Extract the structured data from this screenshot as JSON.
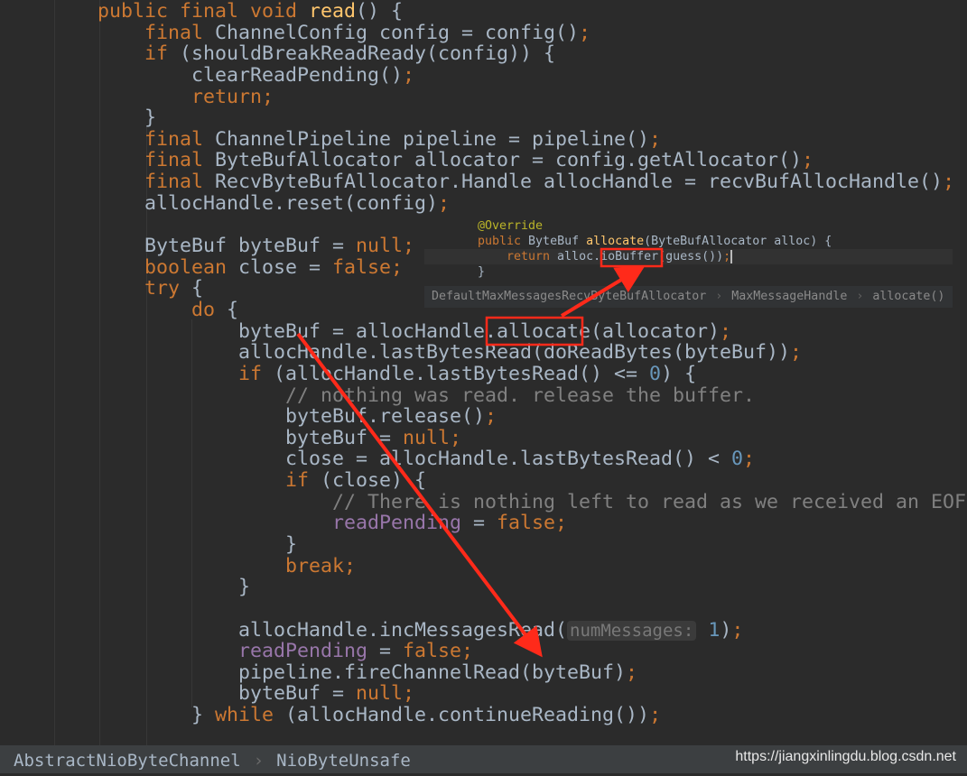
{
  "editor": {
    "lines": [
      {
        "indent": 0,
        "tokens": [
          [
            "k",
            "public final void "
          ],
          [
            "m",
            "read"
          ],
          [
            "t",
            "() {"
          ]
        ]
      },
      {
        "indent": 1,
        "tokens": [
          [
            "k",
            "final "
          ],
          [
            "t",
            "ChannelConfig config = config()"
          ],
          [
            "k",
            ";"
          ]
        ]
      },
      {
        "indent": 1,
        "tokens": [
          [
            "k",
            "if "
          ],
          [
            "t",
            "(shouldBreakReadReady(config)) {"
          ]
        ]
      },
      {
        "indent": 2,
        "tokens": [
          [
            "t",
            "clearReadPending()"
          ],
          [
            "k",
            ";"
          ]
        ]
      },
      {
        "indent": 2,
        "tokens": [
          [
            "k",
            "return;"
          ]
        ]
      },
      {
        "indent": 1,
        "tokens": [
          [
            "t",
            "}"
          ]
        ]
      },
      {
        "indent": 1,
        "tokens": [
          [
            "k",
            "final "
          ],
          [
            "t",
            "ChannelPipeline pipeline = pipeline()"
          ],
          [
            "k",
            ";"
          ]
        ]
      },
      {
        "indent": 1,
        "tokens": [
          [
            "k",
            "final "
          ],
          [
            "t",
            "ByteBufAllocator allocator = config.getAllocator()"
          ],
          [
            "k",
            ";"
          ]
        ]
      },
      {
        "indent": 1,
        "tokens": [
          [
            "k",
            "final "
          ],
          [
            "t",
            "RecvByteBufAllocator.Handle allocHandle = recvBufAllocHandle()"
          ],
          [
            "k",
            ";"
          ]
        ]
      },
      {
        "indent": 1,
        "tokens": [
          [
            "t",
            "allocHandle.reset(config)"
          ],
          [
            "k",
            ";"
          ]
        ]
      },
      {
        "indent": 0,
        "tokens": []
      },
      {
        "indent": 1,
        "tokens": [
          [
            "t",
            "ByteBuf byteBuf = "
          ],
          [
            "k",
            "null;"
          ]
        ]
      },
      {
        "indent": 1,
        "tokens": [
          [
            "k",
            "boolean "
          ],
          [
            "t",
            "close = "
          ],
          [
            "k",
            "false;"
          ]
        ]
      },
      {
        "indent": 1,
        "tokens": [
          [
            "k",
            "try "
          ],
          [
            "t",
            "{"
          ]
        ]
      },
      {
        "indent": 2,
        "tokens": [
          [
            "k",
            "do "
          ],
          [
            "t",
            "{"
          ]
        ]
      },
      {
        "indent": 3,
        "tokens": [
          [
            "t",
            "byteBuf = allocHandle.allocate(allocator)"
          ],
          [
            "k",
            ";"
          ]
        ]
      },
      {
        "indent": 3,
        "tokens": [
          [
            "t",
            "allocHandle.lastBytesRead(doReadBytes(byteBuf))"
          ],
          [
            "k",
            ";"
          ]
        ]
      },
      {
        "indent": 3,
        "tokens": [
          [
            "k",
            "if "
          ],
          [
            "t",
            "(allocHandle.lastBytesRead() <= "
          ],
          [
            "n",
            "0"
          ],
          [
            "t",
            ") {"
          ]
        ]
      },
      {
        "indent": 4,
        "tokens": [
          [
            "c",
            "// nothing was read. release the buffer."
          ]
        ]
      },
      {
        "indent": 4,
        "tokens": [
          [
            "t",
            "byteBuf.release()"
          ],
          [
            "k",
            ";"
          ]
        ]
      },
      {
        "indent": 4,
        "tokens": [
          [
            "t",
            "byteBuf = "
          ],
          [
            "k",
            "null;"
          ]
        ]
      },
      {
        "indent": 4,
        "tokens": [
          [
            "t",
            "close = allocHandle.lastBytesRead() < "
          ],
          [
            "n",
            "0"
          ],
          [
            "k",
            ";"
          ]
        ]
      },
      {
        "indent": 4,
        "tokens": [
          [
            "k",
            "if "
          ],
          [
            "t",
            "(close) {"
          ]
        ]
      },
      {
        "indent": 5,
        "tokens": [
          [
            "c",
            "// There is nothing left to read as we received an EOF."
          ]
        ]
      },
      {
        "indent": 5,
        "tokens": [
          [
            "f",
            "readPending"
          ],
          [
            "t",
            " = "
          ],
          [
            "k",
            "false;"
          ]
        ]
      },
      {
        "indent": 4,
        "tokens": [
          [
            "t",
            "}"
          ]
        ]
      },
      {
        "indent": 4,
        "tokens": [
          [
            "k",
            "break;"
          ]
        ]
      },
      {
        "indent": 3,
        "tokens": [
          [
            "t",
            "}"
          ]
        ]
      },
      {
        "indent": 0,
        "tokens": []
      },
      {
        "indent": 3,
        "tokens": [
          [
            "t",
            "allocHandle.incMessagesRead("
          ],
          [
            "h",
            "numMessages:"
          ],
          [
            "t",
            " "
          ],
          [
            "n",
            "1"
          ],
          [
            "t",
            ")"
          ],
          [
            "k",
            ";"
          ]
        ]
      },
      {
        "indent": 3,
        "tokens": [
          [
            "f",
            "readPending"
          ],
          [
            "t",
            " = "
          ],
          [
            "k",
            "false;"
          ]
        ]
      },
      {
        "indent": 3,
        "tokens": [
          [
            "t",
            "pipeline.fireChannelRead(byteBuf)"
          ],
          [
            "k",
            ";"
          ]
        ]
      },
      {
        "indent": 3,
        "tokens": [
          [
            "t",
            "byteBuf = "
          ],
          [
            "k",
            "null;"
          ]
        ]
      },
      {
        "indent": 2,
        "tokens": [
          [
            "t",
            "} "
          ],
          [
            "k",
            "while "
          ],
          [
            "t",
            "(allocHandle.continueReading())"
          ],
          [
            "k",
            ";"
          ]
        ]
      }
    ]
  },
  "popup": {
    "lines": [
      {
        "indent": 0,
        "tokens": [
          [
            "a",
            "@Override"
          ]
        ]
      },
      {
        "indent": 0,
        "tokens": [
          [
            "k",
            "public "
          ],
          [
            "t",
            "ByteBuf "
          ],
          [
            "m",
            "allocate"
          ],
          [
            "t",
            "(ByteBufAllocator alloc) {"
          ]
        ]
      },
      {
        "indent": 1,
        "tokens": [
          [
            "k",
            "return "
          ],
          [
            "t",
            "alloc.ioBuffer(guess())"
          ],
          [
            "k",
            ";"
          ]
        ]
      },
      {
        "indent": 0,
        "tokens": [
          [
            "t",
            "}"
          ]
        ]
      }
    ],
    "breadcrumb": [
      "DefaultMaxMessagesRecvByteBufAllocator",
      "MaxMessageHandle",
      "allocate()"
    ]
  },
  "status": {
    "breadcrumb": [
      "AbstractNioByteChannel",
      "NioByteUnsafe"
    ],
    "separator": "›",
    "watermark": "https://jiangxinlingdu.blog.csdn.net"
  },
  "colors": {
    "background": "#2b2b2b",
    "keyword": "#cc7832",
    "text": "#a9b7c6",
    "method": "#ffc66d",
    "comment": "#808080",
    "number": "#6897bb",
    "field": "#9876aa",
    "annotation": "#bbb529",
    "annotation_red": "#ff2a1a"
  }
}
